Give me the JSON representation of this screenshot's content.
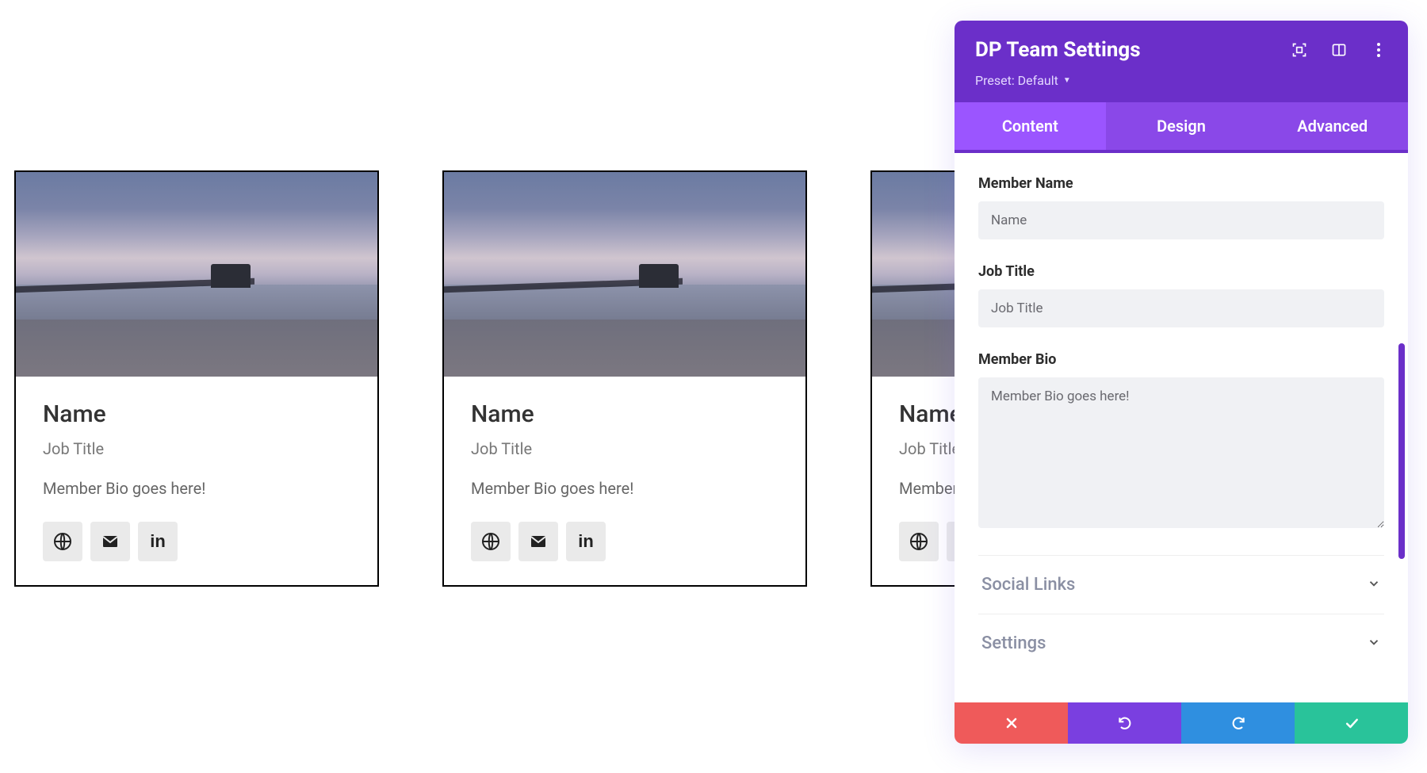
{
  "cards": [
    {
      "name": "Name",
      "job": "Job Title",
      "bio": "Member Bio goes here!"
    },
    {
      "name": "Name",
      "job": "Job Title",
      "bio": "Member Bio goes here!"
    },
    {
      "name": "Name",
      "job": "Job Title",
      "bio": "Member Bio goes here!"
    }
  ],
  "social_icons": [
    "globe-icon",
    "mail-icon",
    "linkedin-icon"
  ],
  "panel": {
    "title": "DP Team Settings",
    "preset_label": "Preset: Default",
    "tabs": {
      "content": "Content",
      "design": "Design",
      "advanced": "Advanced"
    },
    "active_tab": "content",
    "fields": {
      "member_name": {
        "label": "Member Name",
        "value": "Name"
      },
      "job_title": {
        "label": "Job Title",
        "value": "Job Title"
      },
      "member_bio": {
        "label": "Member Bio",
        "value": "Member Bio goes here!"
      }
    },
    "sections": {
      "social_links": "Social Links",
      "settings": "Settings"
    },
    "footer": {
      "cancel": "cancel",
      "undo": "undo",
      "redo": "redo",
      "save": "save"
    },
    "colors": {
      "header": "#6b2fc9",
      "tab": "#8a48e8",
      "tab_active": "#9b55ff",
      "cancel": "#ef5a5a",
      "undo": "#7a3fe0",
      "redo": "#2f8fe0",
      "save": "#29c39a"
    }
  }
}
